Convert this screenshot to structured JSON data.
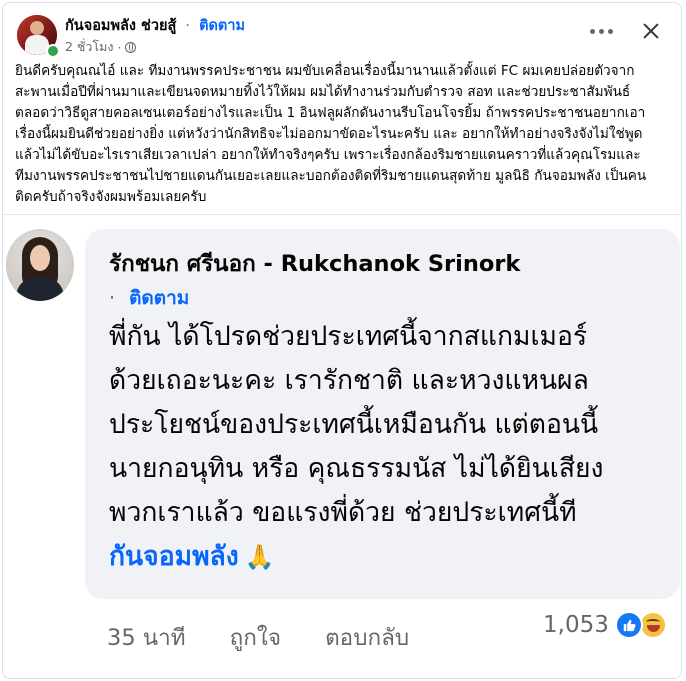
{
  "post": {
    "author": "กันจอมพลัง ช่วยสู้",
    "dot": "·",
    "follow_label": "ติดตาม",
    "time": "2 ชั่วโมง",
    "time_dot": "·",
    "text_lines": [
      "ยินดีครับคุณณไอ์ และ ทีมงานพรรคประชาชน ผมขับเคลื่อนเรื่องนี้มานานแล้วตั้งแต่ FC ผมเคยปล่อยตัวจาก",
      "สะพานเมื่อปีที่ผ่านมาและเขียนจดหมายทิ้งไว้ให้ผม ผมได้ทำงานร่วมกับตำรวจ สอท และช่วยประชาสัมพันธ์",
      "ตลอดว่าวิธีดูสายคอลเซนเตอร์อย่างไรและเป็น 1 อินฟลูผลักดันงานรีบโอนโจรยิ้ม ถ้าพรรคประชาชนอยากเอา",
      "เรื่องนี้ผมยินดีช่วยอย่างยิ่ง แต่หวังว่านักสิทธิจะไม่ออกมาขัดอะไรนะครับ และ อยากให้ทำอย่างจริงจังไม่ใช่พูด",
      "แล้วไม่ได้ขับอะไรเราเสียเวลาเปล่า อยากให้ทำจริงๆครับ เพราะเรื่องกล้องริมชายแดนคราวที่แล้วคุณโรมและ",
      "ทีมงานพรรคประชาชนไปชายแดนกันเยอะเลยและบอกต้องติดที่ริมชายแดนสุดท้าย มูลนิธิ กันจอมพลัง เป็นคน",
      "ติดครับถ้าจริงจังผมพร้อมเลยครับ"
    ]
  },
  "shared": {
    "name": "รักชนก ศรีนอก - Rukchanok Srinork",
    "dot": "·",
    "follow_label": "ติดตาม",
    "body_lines": [
      "พี่กัน ได้โปรดช่วยประเทศนี้จากสแกมเมอร์",
      "ด้วยเถอะนะคะ เรารักชาติ และหวงแหนผล",
      "ประโยชน์ของประเทศนี้เหมือนกัน แต่ตอนนี้",
      "นายกอนุทิน หรือ คุณธรรมนัส ไม่ได้ยินเสียง",
      "พวกเราแล้ว ขอแรงพี่ด้วย ช่วยประเทศนี้ที"
    ],
    "mention": "กันจอมพลัง",
    "mention_emoji": "🙏"
  },
  "actions": {
    "time": "35 นาที",
    "like_label": "ถูกใจ",
    "reply_label": "ตอบกลับ",
    "reaction_count": "1,053"
  },
  "icons": {
    "more": "more-options-icon",
    "close": "close-icon",
    "privacy": "globe-icon",
    "like": "like-reaction-icon",
    "haha": "haha-reaction-icon"
  },
  "colors": {
    "accent": "#0866ff",
    "secondary_text": "#65676b",
    "bubble_bg": "#f0f2f5",
    "online": "#31a24c"
  }
}
